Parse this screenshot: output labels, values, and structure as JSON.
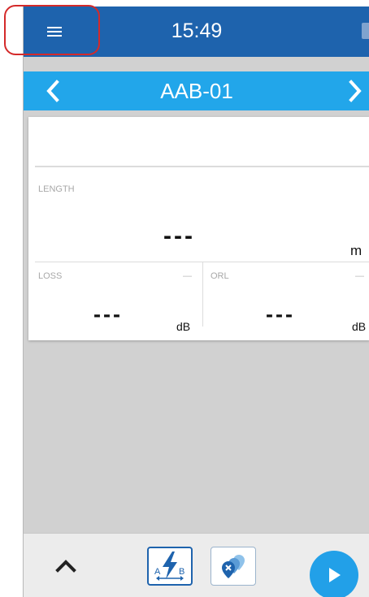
{
  "status_bar": {
    "time": "15:49",
    "menu_icon": "hamburger-menu-icon",
    "battery_icon": "battery-icon",
    "color": "#1e63ad"
  },
  "title_bar": {
    "title": "AAB-01",
    "prev_icon": "chevron-left-icon",
    "next_icon": "chevron-right-icon",
    "color": "#22a6ea"
  },
  "result_card": {
    "length": {
      "label": "LENGTH",
      "value": "---",
      "unit": "m"
    },
    "loss": {
      "label": "LOSS",
      "indicator": "—",
      "value": "---",
      "unit": "dB"
    },
    "orl": {
      "label": "ORL",
      "indicator": "—",
      "value": "---",
      "unit": "dB"
    }
  },
  "toolbar": {
    "expand_icon": "chevron-up-icon",
    "tool_ab": {
      "icon": "lightning-ab-icon",
      "letter_a": "A",
      "letter_b": "B",
      "active": true
    },
    "tool_pins": {
      "icon": "fault-locator-pins-icon",
      "active": false
    },
    "play_icon": "play-icon",
    "accent": "#22a0e8"
  },
  "annotation": {
    "color": "#d42a2a"
  }
}
